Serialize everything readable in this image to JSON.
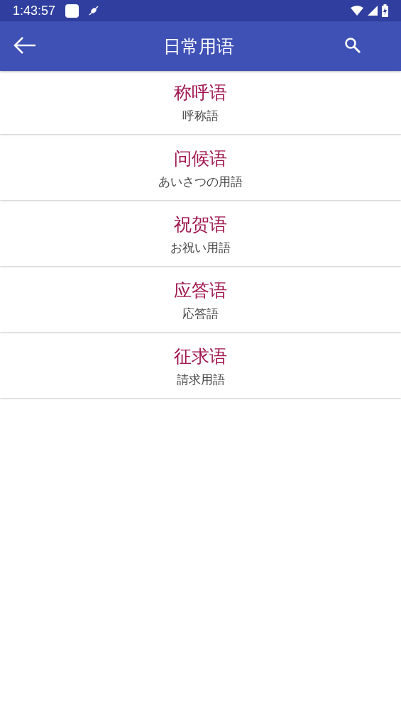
{
  "status_bar": {
    "time": "1:43:57"
  },
  "app_bar": {
    "title": "日常用语"
  },
  "categories": [
    {
      "title": "称呼语",
      "subtitle": "呼称語"
    },
    {
      "title": "问候语",
      "subtitle": "あいさつの用語"
    },
    {
      "title": "祝贺语",
      "subtitle": "お祝い用語"
    },
    {
      "title": "应答语",
      "subtitle": "応答語"
    },
    {
      "title": "征求语",
      "subtitle": "請求用語"
    }
  ]
}
